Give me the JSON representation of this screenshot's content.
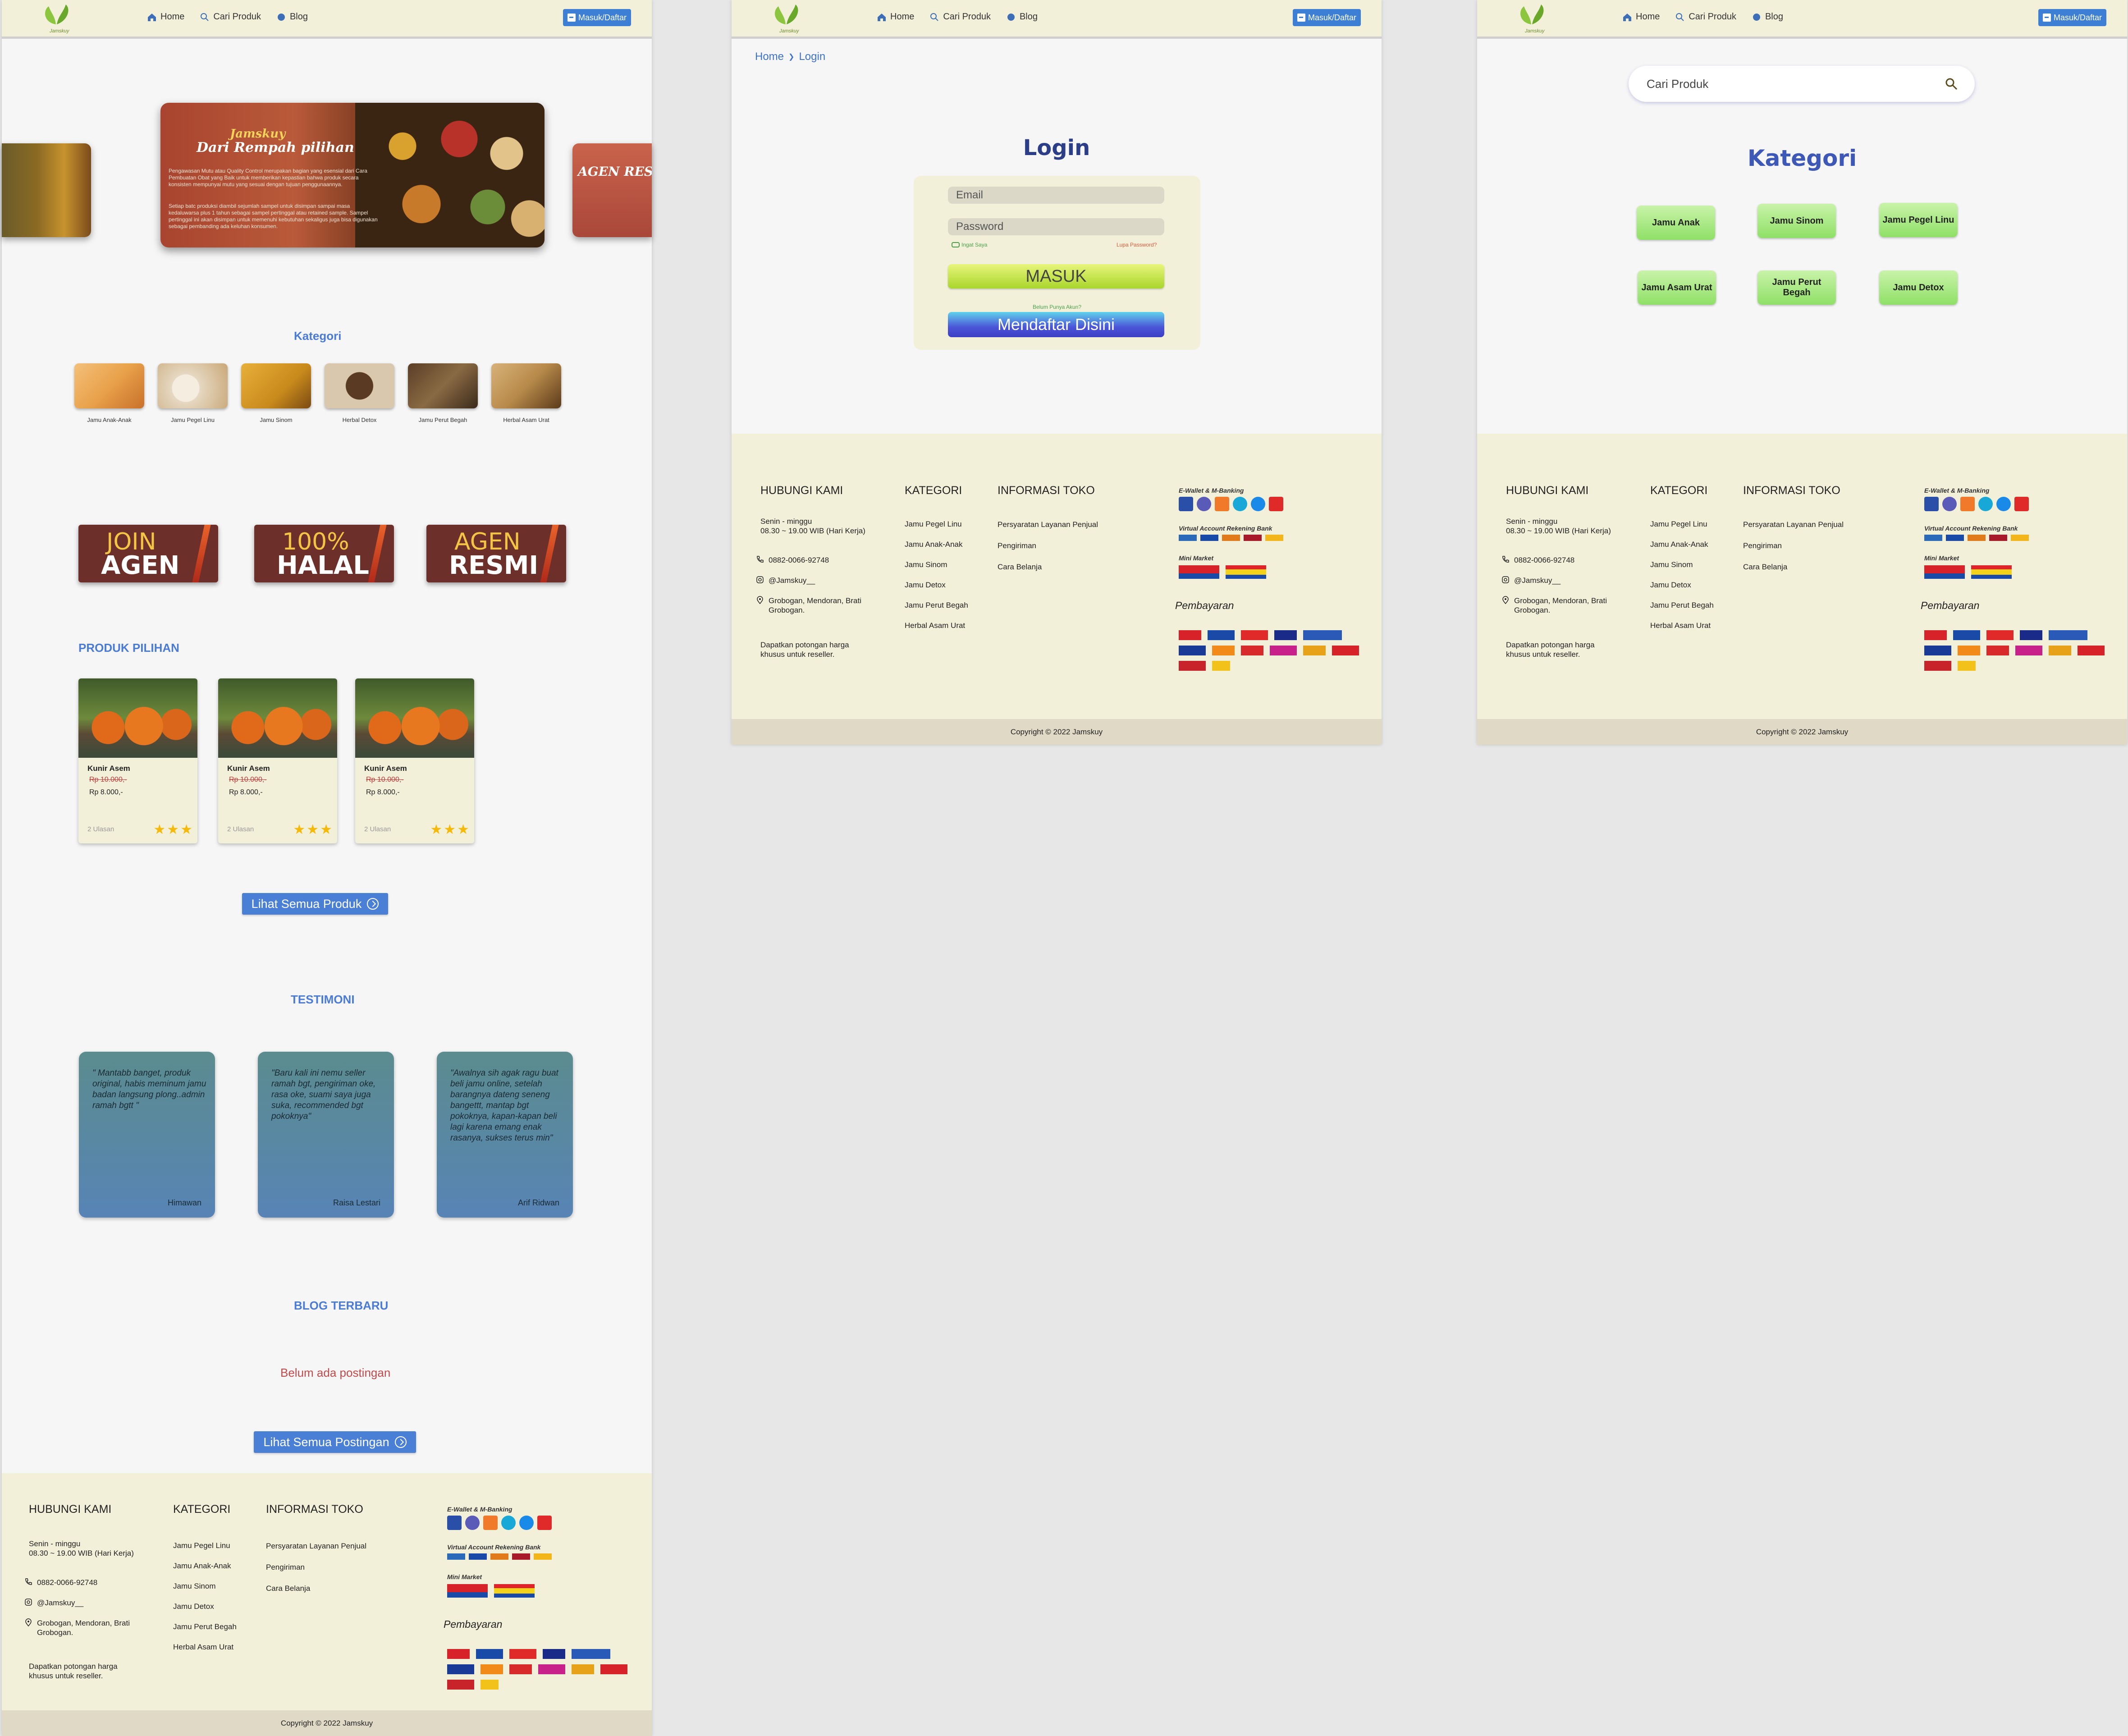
{
  "nav": {
    "home": "Home",
    "cari": "Cari Produk",
    "blog": "Blog",
    "masuk": "Masuk/Daftar"
  },
  "hero": {
    "brand": "Jamskuy",
    "title": "Dari Rempah pilihan",
    "p1": "Pengawasan Mutu atau Quality Control merupakan bagian yang esensial dari Cara Pembuatan Obat yang Baik untuk memberikan kepastian bahwa produk secara konsisten mempunyai mutu yang sesuai dengan tujuan penggunaannya.",
    "p2": "Setiap batc produksi diambil sejumlah sampel untuk disimpan sampai masa kedaluwarsa plus 1 tahun sebagai sampel pertinggal atau retained sample. Sampel pertinggal ini akan disimpan untuk memenuhi kebutuhan sekaligus juga bisa digunakan sebagai pembanding ada keluhan konsumen.",
    "right": "AGEN RESMI"
  },
  "kategori": {
    "title": "Kategori",
    "items": [
      {
        "label": "Jamu Anak-Anak",
        "color": "#e9a24a"
      },
      {
        "label": "Jamu Pegel Linu",
        "color": "#e6d8c2"
      },
      {
        "label": "Jamu Sinom",
        "color": "#c98a1c"
      },
      {
        "label": "Herbal Detox",
        "color": "#8a6648"
      },
      {
        "label": "Jamu Perut Begah",
        "color": "#7b5a3a"
      },
      {
        "label": "Herbal Asam Urat",
        "color": "#b88a4a"
      }
    ]
  },
  "badges": [
    {
      "l1": "JOIN",
      "l2": "AGEN"
    },
    {
      "l1": "100%",
      "l2": "HALAL"
    },
    {
      "l1": "AGEN",
      "l2": "RESMI"
    }
  ],
  "produk": {
    "title": "PRODUK PILIHAN",
    "items": [
      {
        "name": "Kunir Asem",
        "old": "Rp 10.000,-",
        "price": "Rp 8.000,-",
        "reviews": "2 Ulasan",
        "rating": 3
      },
      {
        "name": "Kunir Asem",
        "old": "Rp 10.000,-",
        "price": "Rp 8.000,-",
        "reviews": "2 Ulasan",
        "rating": 3
      },
      {
        "name": "Kunir Asem",
        "old": "Rp 10.000,-",
        "price": "Rp 8.000,-",
        "reviews": "2 Ulasan",
        "rating": 3
      }
    ],
    "btn": "Lihat Semua Produk",
    "stars": "★★★"
  },
  "testimoni": {
    "title": "TESTIMONI",
    "items": [
      {
        "text": "\" Mantabb banget, produk original, habis meminum jamu badan langsung plong..admin ramah bgtt \"",
        "author": "Himawan"
      },
      {
        "text": "\"Baru kali ini nemu seller ramah bgt, pengiriman oke, rasa oke, suami saya juga suka, recommended bgt pokoknya\"",
        "author": "Raisa Lestari"
      },
      {
        "text": "\"Awalnya sih agak ragu buat beli jamu online, setelah barangnya dateng seneng bangettt, mantap bgt pokoknya, kapan-kapan beli lagi karena emang enak rasanya, sukses terus min\"",
        "author": "Arif Ridwan"
      }
    ]
  },
  "blog": {
    "title": "BLOG TERBARU",
    "empty": "Belum ada postingan",
    "btn": "Lihat Semua Postingan"
  },
  "footer": {
    "hubungi": "HUBUNGI KAMI",
    "jam1": "Senin - minggu",
    "jam2": "08.30 ~ 19.00 WIB (Hari Kerja)",
    "phone": "0882-0066-92748",
    "ig": "@Jamskuy__",
    "addr1": "Grobogan, Mendoran, Brati",
    "addr2": "Grobogan.",
    "promo1": "Dapatkan potongan harga",
    "promo2": "khusus untuk reseller.",
    "kategori": "KATEGORI",
    "kat_items": [
      "Jamu Pegel Linu",
      "Jamu Anak-Anak",
      "Jamu Sinom",
      "Jamu Detox",
      "Jamu Perut Begah",
      "Herbal Asam Urat"
    ],
    "info": "INFORMASI TOKO",
    "info_items": [
      "Persyaratan Layanan Penjual",
      "Pengiriman",
      "Cara Belanja"
    ],
    "ewallet": "E-Wallet & M-Banking",
    "va": "Virtual Account Rekening Bank",
    "mini": "Mini Market",
    "pembayaran": "Pembayaran",
    "copyright": "Copyright © 2022 Jamskuy"
  },
  "login": {
    "crumb_home": "Home",
    "crumb_sep": "❯",
    "crumb_login": "Login",
    "title": "Login",
    "email": "Email",
    "password": "Password",
    "ingat": "Ingat Saya",
    "lupa": "Lupa Password?",
    "masuk": "MASUK",
    "belum": "Belum Punya Akun?",
    "daftar": "Mendaftar Disini"
  },
  "cari": {
    "placeholder": "Cari Produk",
    "title": "Kategori",
    "items": [
      "Jamu Anak",
      "Jamu Sinom",
      "Jamu Pegel Linu",
      "Jamu Asam Urat",
      "Jamu Perut Begah",
      "Jamu Detox"
    ]
  }
}
